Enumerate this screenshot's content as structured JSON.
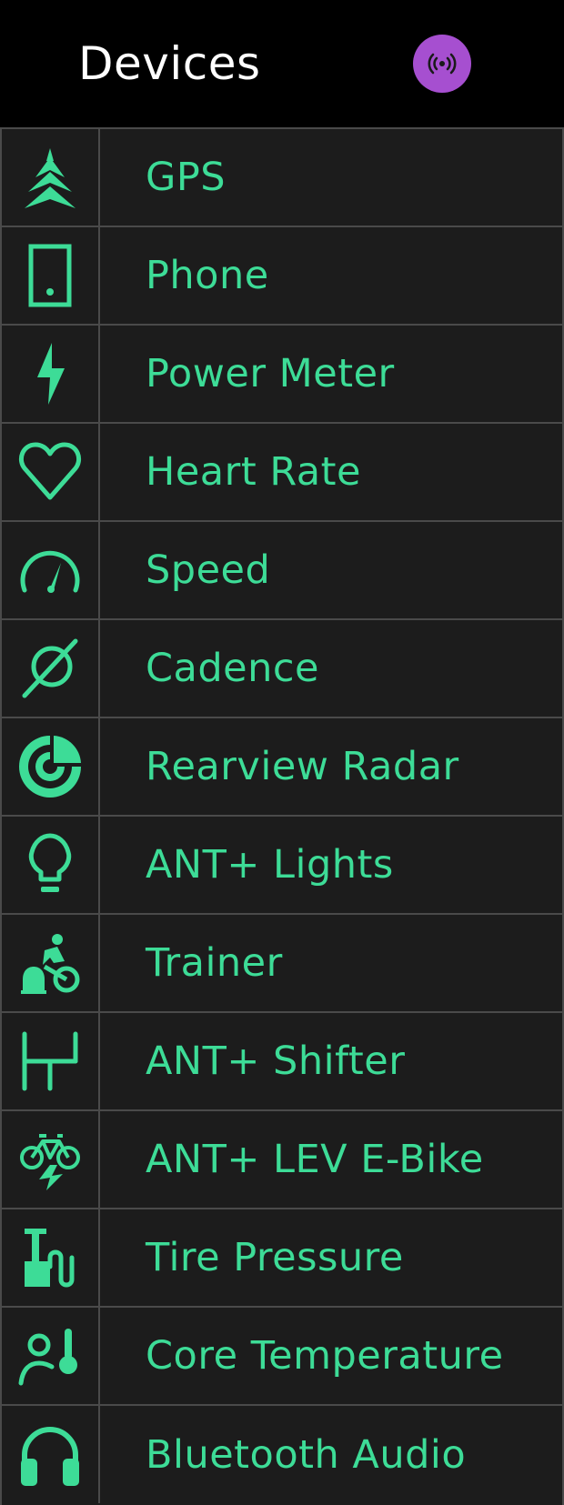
{
  "header": {
    "title": "Devices",
    "scan_icon": "broadcast-icon",
    "scan_color": "#a64fd0"
  },
  "accent_color": "#3ddc97",
  "devices": [
    {
      "label": "GPS",
      "icon": "gps-arrows-icon"
    },
    {
      "label": "Phone",
      "icon": "phone-icon"
    },
    {
      "label": "Power Meter",
      "icon": "lightning-icon"
    },
    {
      "label": "Heart Rate",
      "icon": "heart-icon"
    },
    {
      "label": "Speed",
      "icon": "speedometer-icon"
    },
    {
      "label": "Cadence",
      "icon": "cadence-icon"
    },
    {
      "label": "Rearview Radar",
      "icon": "radar-icon"
    },
    {
      "label": "ANT+ Lights",
      "icon": "lightbulb-icon"
    },
    {
      "label": "Trainer",
      "icon": "trainer-icon"
    },
    {
      "label": "ANT+ Shifter",
      "icon": "shifter-icon"
    },
    {
      "label": "ANT+ LEV E-Bike",
      "icon": "ebike-icon"
    },
    {
      "label": "Tire Pressure",
      "icon": "tire-pressure-icon"
    },
    {
      "label": "Core Temperature",
      "icon": "core-temperature-icon"
    },
    {
      "label": "Bluetooth Audio",
      "icon": "headphones-icon"
    }
  ]
}
